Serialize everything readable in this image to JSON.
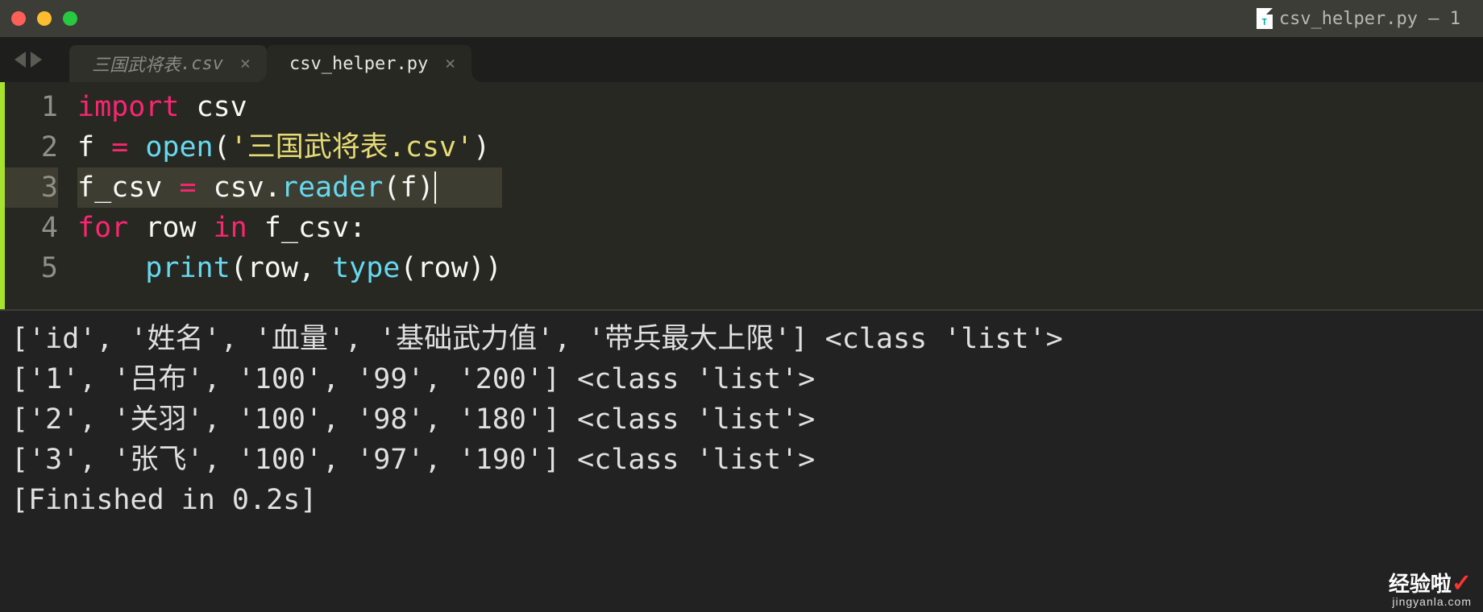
{
  "window": {
    "title": "csv_helper.py — 1"
  },
  "tabs": [
    {
      "name": "三国武将表",
      "ext": ".csv",
      "active": false
    },
    {
      "name": "csv_helper.py",
      "ext": "",
      "active": true
    }
  ],
  "code": {
    "lines": [
      {
        "n": "1",
        "tokens": [
          {
            "t": "import",
            "c": "kw"
          },
          {
            "t": " ",
            "c": "pl"
          },
          {
            "t": "csv",
            "c": "pl"
          }
        ]
      },
      {
        "n": "2",
        "tokens": [
          {
            "t": "f ",
            "c": "pl"
          },
          {
            "t": "=",
            "c": "op"
          },
          {
            "t": " ",
            "c": "pl"
          },
          {
            "t": "open",
            "c": "fn"
          },
          {
            "t": "(",
            "c": "pl"
          },
          {
            "t": "'三国武将表.csv'",
            "c": "str"
          },
          {
            "t": ")",
            "c": "pl"
          }
        ]
      },
      {
        "n": "3",
        "hl": true,
        "tokens": [
          {
            "t": "f_csv ",
            "c": "pl"
          },
          {
            "t": "=",
            "c": "op"
          },
          {
            "t": " csv.",
            "c": "pl"
          },
          {
            "t": "reader",
            "c": "fn"
          },
          {
            "t": "(f)",
            "c": "pl",
            "cursor": true
          }
        ]
      },
      {
        "n": "4",
        "tokens": [
          {
            "t": "for",
            "c": "kw"
          },
          {
            "t": " row ",
            "c": "pl"
          },
          {
            "t": "in",
            "c": "kw"
          },
          {
            "t": " f_csv:",
            "c": "pl"
          }
        ]
      },
      {
        "n": "5",
        "tokens": [
          {
            "t": "    ",
            "c": "pl"
          },
          {
            "t": "print",
            "c": "fn"
          },
          {
            "t": "(row, ",
            "c": "pl"
          },
          {
            "t": "type",
            "c": "fn"
          },
          {
            "t": "(row))",
            "c": "pl"
          }
        ]
      }
    ]
  },
  "console": {
    "lines": [
      "['id', '姓名', '血量', '基础武力值', '带兵最大上限'] <class 'list'>",
      "['1', '吕布', '100', '99', '200'] <class 'list'>",
      "['2', '关羽', '100', '98', '180'] <class 'list'>",
      "['3', '张飞', '100', '97', '190'] <class 'list'>",
      "[Finished in 0.2s]"
    ]
  },
  "watermark": {
    "big": "经验啦",
    "check": "✓",
    "small": "jingyanla.com"
  }
}
